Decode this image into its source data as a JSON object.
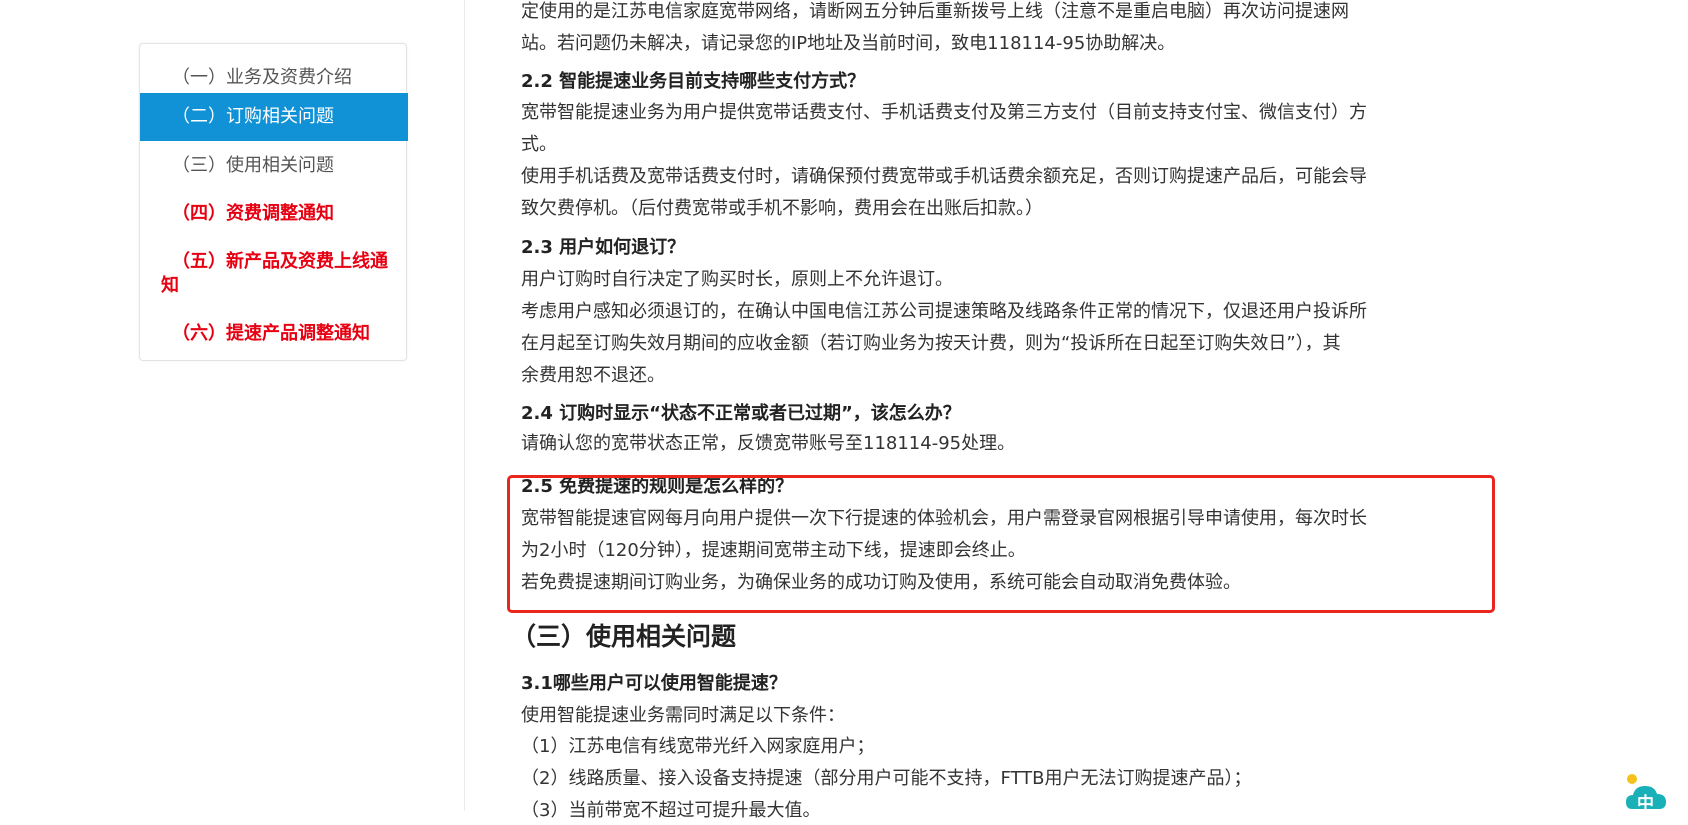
{
  "sidebar": {
    "items": [
      {
        "label": "（一）业务及资费介绍"
      },
      {
        "label": "（二）订购相关问题"
      },
      {
        "label": "（三）使用相关问题"
      },
      {
        "label": "（四）资费调整通知"
      },
      {
        "label": "（五）新产品及资费上线通知"
      },
      {
        "label": "（六）提速产品调整通知"
      }
    ]
  },
  "content": {
    "p_top1": "定使用的是江苏电信家庭宽带网络，请断网五分钟后重新拨号上线（注意不是重启电脑）再次访问提速网",
    "p_top2": "站。若问题仍未解决，请记录您的IP地址及当前时间，致电118114-95协助解决。",
    "q22": "2.2 智能提速业务目前支持哪些支付方式？",
    "a22_1": "宽带智能提速业务为用户提供宽带话费支付、手机话费支付及第三方支付（目前支持支付宝、微信支付）方",
    "a22_2": "式。",
    "a22_3": "使用手机话费及宽带话费支付时，请确保预付费宽带或手机话费余额充足，否则订购提速产品后，可能会导",
    "a22_4": "致欠费停机。（后付费宽带或手机不影响，费用会在出账后扣款。）",
    "q23": "2.3 用户如何退订？",
    "a23_1": "用户订购时自行决定了购买时长，原则上不允许退订。",
    "a23_2": "考虑用户感知必须退订的，在确认中国电信江苏公司提速策略及线路条件正常的情况下，仅退还用户投诉所",
    "a23_3": "在月起至订购失效月期间的应收金额（若订购业务为按天计费，则为“投诉所在日起至订购失效日”），其",
    "a23_4": "余费用恕不退还。",
    "q24": "2.4 订购时显示“状态不正常或者已过期”，该怎么办？",
    "a24_1": "请确认您的宽带状态正常，反馈宽带账号至118114-95处理。",
    "q25": "2.5 免费提速的规则是怎么样的？",
    "a25_1": "宽带智能提速官网每月向用户提供一次下行提速的体验机会，用户需登录官网根据引导申请使用，每次时长",
    "a25_2": "为2小时（120分钟），提速期间宽带主动下线，提速即会终止。",
    "a25_3": "若免费提速期间订购业务，为确保业务的成功订购及使用，系统可能会自动取消免费体验。",
    "sec3": "（三）使用相关问题",
    "q31": "3.1哪些用户可以使用智能提速？",
    "a31_1": "使用智能提速业务需同时满足以下条件：",
    "a31_2": "（1）江苏电信有线宽带光纤入网家庭用户；",
    "a31_3": "（2）线路质量、接入设备支持提速（部分用户可能不支持，FTTB用户无法订购提速产品）；",
    "a31_4": "（3）当前带宽不超过可提升最大值。"
  },
  "widget": {
    "label": "中",
    "icon": "cloud-chat-icon"
  },
  "colors": {
    "accent": "#1192d6",
    "red": "#e60012",
    "highlight_border": "#e8261c"
  }
}
